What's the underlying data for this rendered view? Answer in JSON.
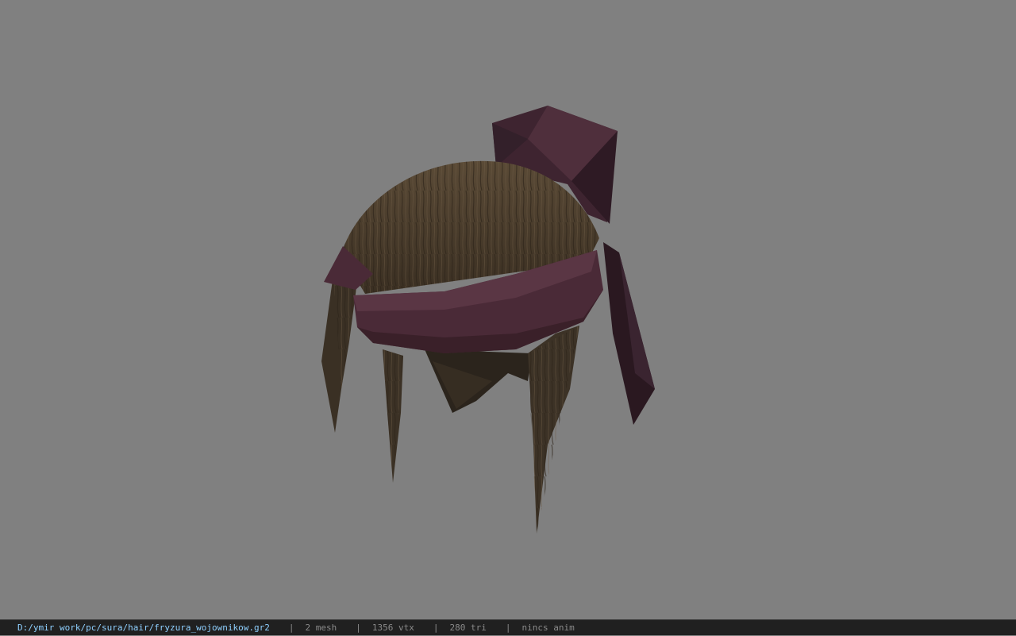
{
  "viewer": {
    "background_color": "#808080",
    "model_name": "fryzura_wojownikow",
    "hair_color": "#4a3d2c",
    "ribbon_color": "#4a2a37"
  },
  "status_bar": {
    "file_path": "D:/ymir work/pc/sura/hair/fryzura_wojownikow.gr2",
    "separator": "|",
    "mesh": "2 mesh",
    "vertices": "1356 vtx",
    "triangles": "280 tri",
    "animation": "nincs anim"
  }
}
